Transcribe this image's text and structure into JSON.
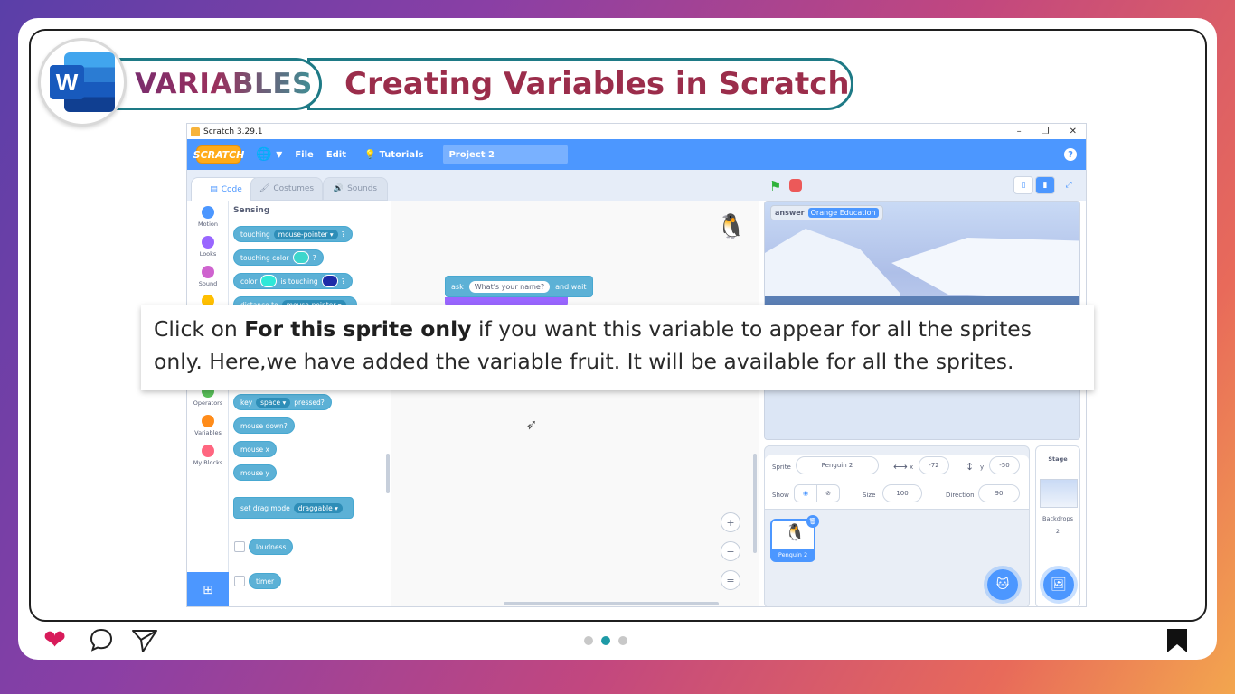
{
  "header": {
    "badge_label": "VARIABLES",
    "title": "Creating Variables in Scratch",
    "app_icon_letter": "W"
  },
  "scratch": {
    "window_title": "Scratch 3.29.1",
    "window_buttons": [
      "–",
      "❐",
      "✕"
    ],
    "menu": {
      "logo": "SCRATCH",
      "globe": "🌐 ▾",
      "file": "File",
      "edit": "Edit",
      "tutorials": "Tutorials",
      "project_name": "Project 2",
      "help": "?"
    },
    "tabs": {
      "code": "Code",
      "costumes": "Costumes",
      "sounds": "Sounds"
    },
    "categories": [
      {
        "label": "Motion",
        "color": "#4c97ff"
      },
      {
        "label": "Looks",
        "color": "#9966ff"
      },
      {
        "label": "Sound",
        "color": "#cf63cf"
      },
      {
        "label": "",
        "color": "#ffbf00"
      },
      {
        "label": "Operators",
        "color": "#59c059"
      },
      {
        "label": "Variables",
        "color": "#ff8c1a"
      },
      {
        "label": "My Blocks",
        "color": "#ff6680"
      }
    ],
    "palette": {
      "title": "Sensing",
      "touching": "touching",
      "touching_opt": "mouse-pointer ▾",
      "q": "?",
      "touching_color": "touching color",
      "color": "color",
      "is_touching": "is touching",
      "distance_to": "distance to",
      "distance_opt": "mouse-pointer ▾",
      "key": "key",
      "key_opt": "space ▾",
      "pressed": "pressed?",
      "mouse_down": "mouse down?",
      "mouse_x": "mouse x",
      "mouse_y": "mouse y",
      "set_drag_mode": "set drag mode",
      "drag_opt": "draggable ▾",
      "loudness": "loudness",
      "timer": "timer"
    },
    "workspace": {
      "ask": "ask",
      "ask_text": "What's your name?",
      "and_wait": "and wait",
      "zoom_in": "+",
      "zoom_out": "−",
      "zoom_reset": "="
    },
    "stage": {
      "answer_label": "answer",
      "answer_value": "Orange Education"
    },
    "sprite_info": {
      "sprite_label": "Sprite",
      "sprite_name": "Penguin 2",
      "x_label": "x",
      "x_value": "-72",
      "y_label": "y",
      "y_value": "-50",
      "show_label": "Show",
      "size_label": "Size",
      "size_value": "100",
      "direction_label": "Direction",
      "direction_value": "90",
      "thumb_name": "Penguin 2"
    },
    "stage_pane": {
      "title": "Stage",
      "backdrops_label": "Backdrops",
      "backdrops_count": "2"
    }
  },
  "callout": {
    "prefix": "Click on ",
    "bold": "For this sprite only",
    "suffix": " if you want this variable to appear for all the sprites only. Here,we have added the variable fruit. It will be available for all the sprites."
  },
  "colors": {
    "scratch_blue": "#4c97ff",
    "sensing_blue": "#5cb1d6",
    "title_color": "#9b2d4b",
    "accent_teal": "#1e7a86",
    "heart": "#d81b5a"
  }
}
